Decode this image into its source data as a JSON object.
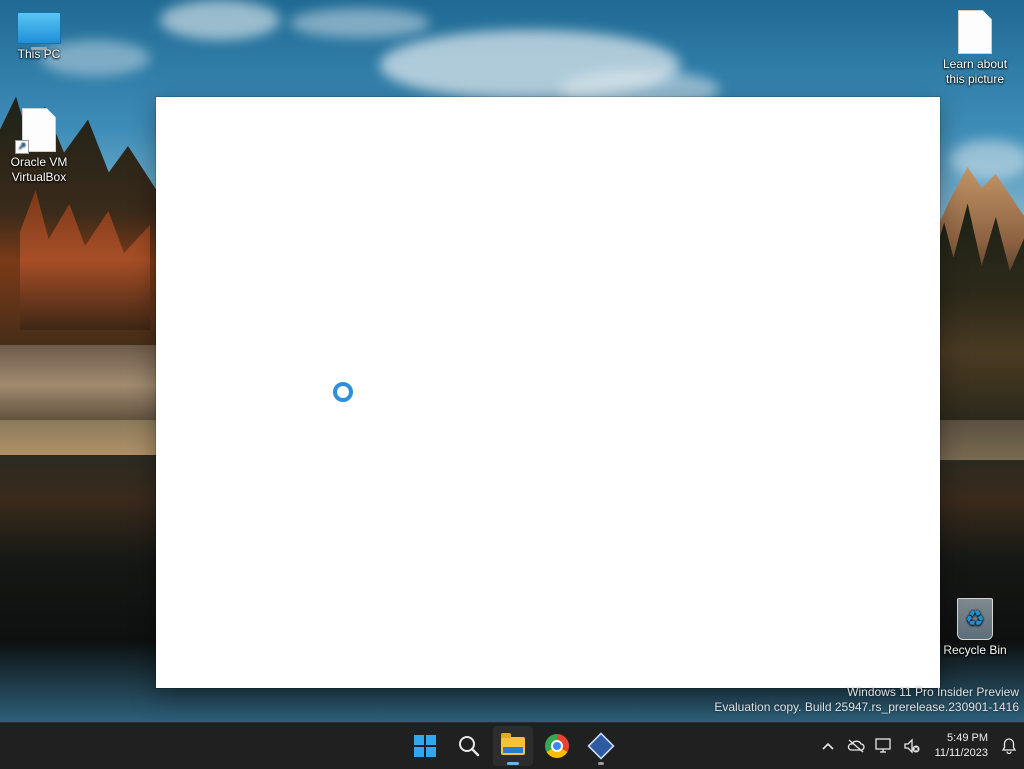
{
  "desktop": {
    "icons": [
      {
        "label_line1": "This PC",
        "label_line2": "",
        "icon": "monitor-icon"
      },
      {
        "label_line1": "Oracle VM",
        "label_line2": "VirtualBox",
        "icon": "shortcut-file-icon"
      },
      {
        "label_line1": "Learn about",
        "label_line2": "this picture",
        "icon": "file-icon"
      },
      {
        "label_line1": "Recycle Bin",
        "label_line2": "",
        "icon": "recycle-bin-icon"
      }
    ]
  },
  "window": {
    "state": "loading",
    "background": "#ffffff",
    "spinner_color": "#2f8fdb"
  },
  "watermark": {
    "line1": "Windows 11 Pro Insider Preview",
    "line2": "Evaluation copy. Build 25947.rs_prerelease.230901-1416"
  },
  "taskbar": {
    "apps": [
      {
        "name": "start",
        "icon": "windows-logo-icon"
      },
      {
        "name": "search",
        "icon": "search-icon"
      },
      {
        "name": "file-explorer",
        "icon": "folder-icon",
        "active": true
      },
      {
        "name": "chrome",
        "icon": "chrome-icon"
      },
      {
        "name": "virtualbox",
        "icon": "virtualbox-icon",
        "running": true
      }
    ],
    "tray": {
      "icons": [
        "chevron-up-icon",
        "onedrive-off-icon",
        "network-icon",
        "volume-muted-icon"
      ],
      "time": "5:49 PM",
      "date": "11/11/2023",
      "notification_icon": "bell-icon"
    },
    "accent_color": "#5cb8f5"
  }
}
